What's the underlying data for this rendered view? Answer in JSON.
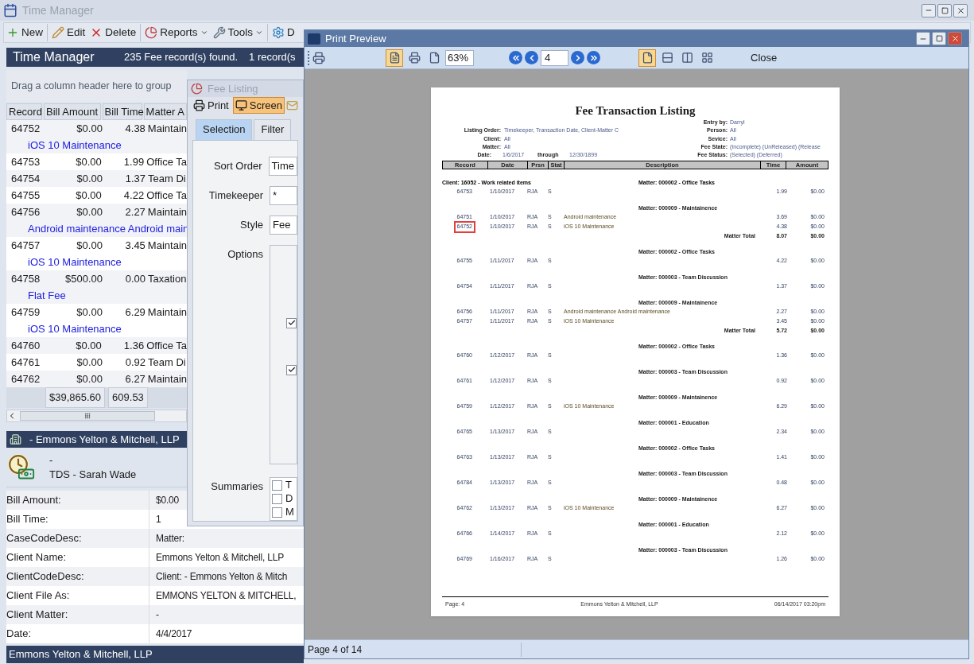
{
  "main_window": {
    "title": "Time Manager",
    "toolbar": [
      {
        "label": "New",
        "dropdown": false
      },
      {
        "label": "Edit",
        "dropdown": false
      },
      {
        "label": "Delete",
        "dropdown": false
      },
      {
        "label": "Reports",
        "dropdown": true
      },
      {
        "label": "Tools",
        "dropdown": true
      },
      {
        "label": "D",
        "dropdown": false
      }
    ],
    "header": {
      "title": "Time Manager",
      "found": "235 Fee record(s) found.",
      "selection": "1 record(s"
    },
    "group_hint": "Drag a column header here to group",
    "grid": {
      "columns": [
        "Record",
        "Bill Amount",
        "Bill Time",
        "Matter A"
      ],
      "rows": [
        {
          "record": "64752",
          "bill_amount": "$0.00",
          "bill_time": "4.38",
          "matter": "Maintain",
          "description": "iOS 10 Maintenance"
        },
        {
          "record": "64753",
          "bill_amount": "$0.00",
          "bill_time": "1.99",
          "matter": "Office Ta"
        },
        {
          "record": "64754",
          "bill_amount": "$0.00",
          "bill_time": "1.37",
          "matter": "Team Di"
        },
        {
          "record": "64755",
          "bill_amount": "$0.00",
          "bill_time": "4.22",
          "matter": "Office Ta"
        },
        {
          "record": "64756",
          "bill_amount": "$0.00",
          "bill_time": "2.27",
          "matter": "Maintain",
          "description": "Android maintenance Android main"
        },
        {
          "record": "64757",
          "bill_amount": "$0.00",
          "bill_time": "3.45",
          "matter": "Maintain",
          "description": "iOS 10 Maintenance"
        },
        {
          "record": "64758",
          "bill_amount": "$500.00",
          "bill_time": "0.00",
          "matter": "Taxation",
          "description": "Flat Fee"
        },
        {
          "record": "64759",
          "bill_amount": "$0.00",
          "bill_time": "6.29",
          "matter": "Maintain",
          "description": "iOS 10 Maintenance"
        },
        {
          "record": "64760",
          "bill_amount": "$0.00",
          "bill_time": "1.36",
          "matter": "Office Ta"
        },
        {
          "record": "64761",
          "bill_amount": "$0.00",
          "bill_time": "0.92",
          "matter": "Team Di"
        },
        {
          "record": "64762",
          "bill_amount": "$0.00",
          "bill_time": "6.27",
          "matter": "Maintain"
        }
      ],
      "totals": [
        "$39,865.60",
        "609.53"
      ]
    },
    "detail": {
      "header": " - Emmons Yelton & Mitchell, LLP",
      "line_1": "-",
      "line_2": "TDS - Sarah Wade",
      "properties": [
        {
          "label": "Bill Amount:",
          "value": "$0.00"
        },
        {
          "label": "Bill Time:",
          "value": "1"
        },
        {
          "label": "CaseCodeDesc:",
          "value": "Matter:"
        },
        {
          "label": "Client Name:",
          "value": "Emmons Yelton & Mitchell, LLP"
        },
        {
          "label": "ClientCodeDesc:",
          "value": "Client:  - Emmons Yelton & Mitch"
        },
        {
          "label": "Client File As:",
          "value": "EMMONS YELTON & MITCHELL,"
        },
        {
          "label": "Client Matter:",
          "value": "-"
        },
        {
          "label": "Date:",
          "value": "4/4/2017"
        }
      ]
    },
    "status_bar": "Emmons Yelton & Mitchell, LLP"
  },
  "fee_listing": {
    "title": "Fee Listing",
    "toolbar": [
      {
        "label": "Print",
        "selected": false
      },
      {
        "label": "Screen",
        "selected": true
      }
    ],
    "tabs": [
      {
        "label": "Selection",
        "selected": true
      },
      {
        "label": "Filter",
        "selected": false
      }
    ],
    "fields": [
      {
        "label": "Sort Order",
        "value": "Time"
      },
      {
        "label": "Timekeeper",
        "value": "*"
      },
      {
        "label": "Style",
        "value": "Fee"
      }
    ],
    "options": {
      "label": "Options",
      "checkboxes": [
        {
          "checked": true
        },
        {
          "checked": true
        }
      ]
    },
    "summaries": {
      "label": "Summaries",
      "items": [
        {
          "label": "T",
          "checked": false
        },
        {
          "label": "D",
          "checked": false
        },
        {
          "label": "M",
          "checked": false
        }
      ]
    }
  },
  "print_preview": {
    "title": "Print Preview",
    "view_buttons": [
      {
        "selected": true
      },
      {
        "selected": false
      },
      {
        "selected": false
      }
    ],
    "zoom": "63%",
    "page": "4",
    "layout_buttons": [
      {
        "selected": true
      },
      {
        "selected": false
      },
      {
        "selected": false
      },
      {
        "selected": false
      }
    ],
    "close": "Close",
    "report": {
      "title": "Fee Transaction Listing",
      "meta_left": [
        {
          "label": "Listing Order:",
          "value": "Timekeeper, Transaction Date, Client-Matter C"
        },
        {
          "label": "Client:",
          "value": "All"
        },
        {
          "label": "Matter:",
          "value": "All"
        }
      ],
      "date_range": {
        "label": "Date:",
        "from": "1/6/2017",
        "through": "through",
        "to": "12/30/1899"
      },
      "meta_right": [
        {
          "label": "Entry by:",
          "value": "Darryl"
        },
        {
          "label": "Person:",
          "value": "All"
        },
        {
          "label": "Sevice:",
          "value": "All"
        },
        {
          "label": "Fee State:",
          "value": "(Incomplete) (UnReleased) (Release"
        },
        {
          "label": "Fee Status:",
          "value": "(Selected) (Deferred)"
        }
      ],
      "columns": [
        "Record",
        "Date",
        "Prsn",
        "Stat",
        "Description",
        "Time",
        "Amount"
      ],
      "rows": [
        {
          "kind": "client",
          "client": "Client: 16052 - Work related items",
          "matter": "Matter: 000002 - Office Tasks"
        },
        {
          "kind": "entry",
          "record": "64753",
          "date": "1/10/2017",
          "prsn": "RJA",
          "stat": "S",
          "time": "1.99",
          "amount": "$0.00",
          "highlighted": false
        },
        {
          "kind": "matter",
          "text": "Matter: 000009 - Maintainence"
        },
        {
          "kind": "entry",
          "record": "64751",
          "date": "1/10/2017",
          "prsn": "RJA",
          "stat": "S",
          "description": "Android maintenance",
          "time": "3.69",
          "amount": "$0.00",
          "highlighted": false
        },
        {
          "kind": "entry",
          "record": "64752",
          "date": "1/10/2017",
          "prsn": "RJA",
          "stat": "S",
          "description": "iOS 10 Maintenance",
          "time": "4.38",
          "amount": "$0.00",
          "highlighted": true
        },
        {
          "kind": "total",
          "label": "Matter Total",
          "time": "8.07",
          "amount": "$0.00"
        },
        {
          "kind": "matter",
          "text": "Matter: 000002 - Office Tasks"
        },
        {
          "kind": "entry",
          "record": "64755",
          "date": "1/11/2017",
          "prsn": "RJA",
          "stat": "S",
          "time": "4.22",
          "amount": "$0.00",
          "highlighted": false
        },
        {
          "kind": "matter",
          "text": "Matter: 000003 - Team Discussion"
        },
        {
          "kind": "entry",
          "record": "64754",
          "date": "1/11/2017",
          "prsn": "RJA",
          "stat": "S",
          "time": "1.37",
          "amount": "$0.00",
          "highlighted": false
        },
        {
          "kind": "matter",
          "text": "Matter: 000009 - Maintainence"
        },
        {
          "kind": "entry",
          "record": "64756",
          "date": "1/11/2017",
          "prsn": "RJA",
          "stat": "S",
          "description": "Android maintenance Android maintenance",
          "time": "2.27",
          "amount": "$0.00",
          "highlighted": false
        },
        {
          "kind": "entry",
          "record": "64757",
          "date": "1/11/2017",
          "prsn": "RJA",
          "stat": "S",
          "description": "iOS 10 Maintenance",
          "time": "3.45",
          "amount": "$0.00",
          "highlighted": false
        },
        {
          "kind": "total",
          "label": "Matter Total",
          "time": "5.72",
          "amount": "$0.00"
        },
        {
          "kind": "matter",
          "text": "Matter: 000002 - Office Tasks"
        },
        {
          "kind": "entry",
          "record": "64760",
          "date": "1/12/2017",
          "prsn": "RJA",
          "stat": "S",
          "time": "1.36",
          "amount": "$0.00",
          "highlighted": false
        },
        {
          "kind": "matter",
          "text": "Matter: 000003 - Team Discussion"
        },
        {
          "kind": "entry",
          "record": "64761",
          "date": "1/12/2017",
          "prsn": "RJA",
          "stat": "S",
          "time": "0.92",
          "amount": "$0.00",
          "highlighted": false
        },
        {
          "kind": "matter",
          "text": "Matter: 000009 - Maintainence"
        },
        {
          "kind": "entry",
          "record": "64759",
          "date": "1/12/2017",
          "prsn": "RJA",
          "stat": "S",
          "description": "iOS 10 Maintenance",
          "time": "6.29",
          "amount": "$0.00",
          "highlighted": false
        },
        {
          "kind": "matter",
          "text": "Matter: 000001 - Education"
        },
        {
          "kind": "entry",
          "record": "64765",
          "date": "1/13/2017",
          "prsn": "RJA",
          "stat": "S",
          "time": "2.34",
          "amount": "$0.00",
          "highlighted": false
        },
        {
          "kind": "matter",
          "text": "Matter: 000002 - Office Tasks"
        },
        {
          "kind": "entry",
          "record": "64763",
          "date": "1/13/2017",
          "prsn": "RJA",
          "stat": "S",
          "time": "1.41",
          "amount": "$0.00",
          "highlighted": false
        },
        {
          "kind": "matter",
          "text": "Matter: 000003 - Team Discussion"
        },
        {
          "kind": "entry",
          "record": "64784",
          "date": "1/13/2017",
          "prsn": "RJA",
          "stat": "S",
          "time": "0.48",
          "amount": "$0.00",
          "highlighted": false
        },
        {
          "kind": "matter",
          "text": "Matter: 000009 - Maintainence"
        },
        {
          "kind": "entry",
          "record": "64762",
          "date": "1/13/2017",
          "prsn": "RJA",
          "stat": "S",
          "description": "iOS 10 Maintenance",
          "time": "6.27",
          "amount": "$0.00",
          "highlighted": false
        },
        {
          "kind": "matter",
          "text": "Matter: 000001 - Education"
        },
        {
          "kind": "entry",
          "record": "64766",
          "date": "1/14/2017",
          "prsn": "RJA",
          "stat": "S",
          "time": "2.12",
          "amount": "$0.00",
          "highlighted": false
        },
        {
          "kind": "matter",
          "text": "Matter: 000003 - Team Discussion"
        },
        {
          "kind": "entry",
          "record": "64769",
          "date": "1/16/2017",
          "prsn": "RJA",
          "stat": "S",
          "time": "1.26",
          "amount": "$0.00",
          "highlighted": false
        }
      ],
      "footer": {
        "page": "Page: 4",
        "company": "Emmons Yelton & Mitchell, LLP",
        "timestamp": "06/14/2017  03:20pm"
      }
    },
    "status_bar": "Page 4 of 14"
  }
}
